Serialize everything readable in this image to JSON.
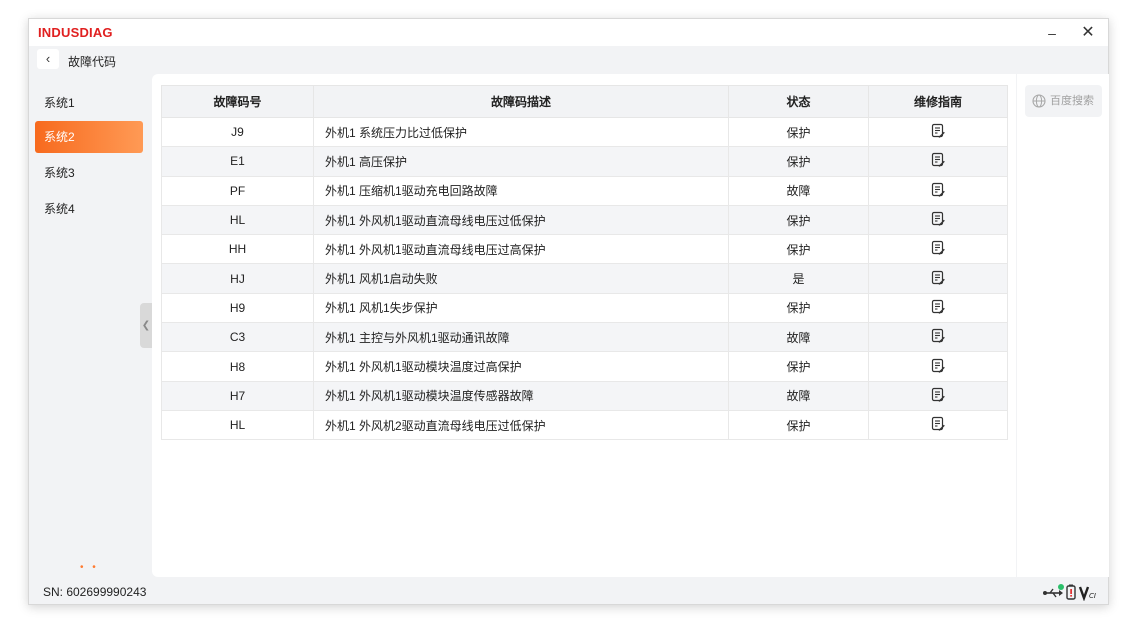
{
  "app": {
    "brand": "INDUSDIAG",
    "min_label": "–",
    "close_label": "✕"
  },
  "nav": {
    "back_label": "‹",
    "title": "故障代码"
  },
  "sidebar": {
    "items": [
      {
        "label": "系统1",
        "active": false
      },
      {
        "label": "系统2",
        "active": true
      },
      {
        "label": "系统3",
        "active": false
      },
      {
        "label": "系统4",
        "active": false
      }
    ],
    "dots": "• •",
    "collapse_label": "❮"
  },
  "table": {
    "headers": {
      "code": "故障码号",
      "desc": "故障码描述",
      "status": "状态",
      "guide": "维修指南"
    },
    "rows": [
      {
        "code": "J9",
        "desc": "外机1 系统压力比过低保护",
        "status": "保护"
      },
      {
        "code": "E1",
        "desc": "外机1 高压保护",
        "status": "保护"
      },
      {
        "code": "PF",
        "desc": "外机1 压缩机1驱动充电回路故障",
        "status": "故障"
      },
      {
        "code": "HL",
        "desc": "外机1 外风机1驱动直流母线电压过低保护",
        "status": "保护"
      },
      {
        "code": "HH",
        "desc": "外机1 外风机1驱动直流母线电压过高保护",
        "status": "保护"
      },
      {
        "code": "HJ",
        "desc": "外机1 风机1启动失败",
        "status": "是"
      },
      {
        "code": "H9",
        "desc": "外机1 风机1失步保护",
        "status": "保护"
      },
      {
        "code": "C3",
        "desc": "外机1 主控与外风机1驱动通讯故障",
        "status": "故障"
      },
      {
        "code": "H8",
        "desc": "外机1 外风机1驱动模块温度过高保护",
        "status": "保护"
      },
      {
        "code": "H7",
        "desc": "外机1 外风机1驱动模块温度传感器故障",
        "status": "故障"
      },
      {
        "code": "HL",
        "desc": "外机1 外风机2驱动直流母线电压过低保护",
        "status": "保护"
      }
    ]
  },
  "right": {
    "search_label": "百度搜索"
  },
  "status": {
    "sn": "SN: 602699990243"
  },
  "colors": {
    "brand": "#e02020",
    "accent": "#f76a1e",
    "usb_ok": "#2bbf6a",
    "battery": "#e02020"
  }
}
